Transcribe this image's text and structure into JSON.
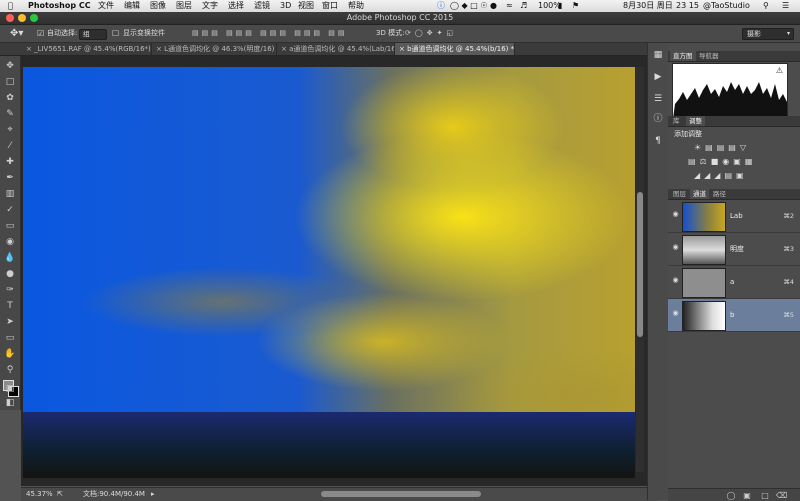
{
  "menubar": {
    "app": "Photoshop CC",
    "items": [
      "文件",
      "编辑",
      "图像",
      "图层",
      "文字",
      "选择",
      "滤镜",
      "3D",
      "视图",
      "窗口",
      "帮助"
    ],
    "battery": "100%",
    "date": "8月30日 周日",
    "time": "23 15",
    "user": "@TaoStudio"
  },
  "window": {
    "title": "Adobe Photoshop CC 2015"
  },
  "options": {
    "auto_select_label": "自动选择:",
    "auto_select_value": "组",
    "transform_label": "显示变换控件",
    "mode_3d_label": "3D 模式:",
    "workspace": "摄影"
  },
  "tabs": [
    "_LIV5651.RAF @ 45.4%(RGB/16*)",
    "L通道色调均化 @ 46.3%(明度/16) *",
    "a通道色调均化 @ 45.4%(Lab/16) *",
    "b通道色调均化 @ 45.4%(b/16) *"
  ],
  "status": {
    "zoom": "45.37%",
    "doc": "文档:90.4M/90.4M"
  },
  "histogram_panel": {
    "tabs": [
      "直方图",
      "导航器"
    ]
  },
  "adjust_panel": {
    "tabs": [
      "库",
      "调整"
    ],
    "title": "添加调整"
  },
  "channels_panel": {
    "tabs": [
      "图层",
      "通道",
      "路径"
    ],
    "channels": [
      {
        "name": "Lab",
        "key": "⌘2"
      },
      {
        "name": "明度",
        "key": "⌘3"
      },
      {
        "name": "a",
        "key": "⌘4"
      },
      {
        "name": "b",
        "key": "⌘5"
      }
    ]
  },
  "colors": {
    "selected_row": "#6b7f9c",
    "accent_tab": "#5a5a5a"
  }
}
